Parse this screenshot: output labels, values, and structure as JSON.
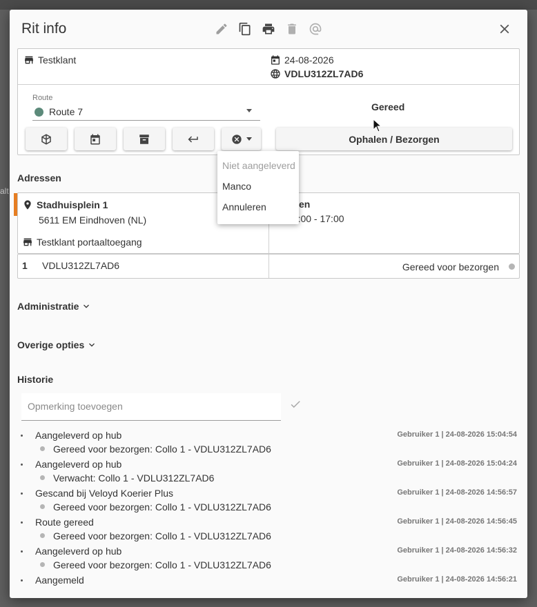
{
  "backdrop": {
    "left_fragment": "alt"
  },
  "dialog": {
    "title": "Rit info",
    "header_icons": [
      "pencil-icon",
      "copy-icon",
      "print-icon",
      "trash-icon",
      "at-icon",
      "close-icon"
    ]
  },
  "info": {
    "customer": "Testklant",
    "date": "24-08-2026",
    "tracking_code": "VDLU312ZL7AD6",
    "route_label": "Route",
    "route_value": "Route 7",
    "route_color": "#5c8a7a",
    "status": "Gereed"
  },
  "actions": {
    "buttons": [
      "box-icon",
      "calendar-icon",
      "archive-icon",
      "return-icon",
      "cancel-dropdown"
    ],
    "wide_button": "Ophalen / Bezorgen"
  },
  "dropdown_menu": {
    "items": [
      "Niet aangeleverd",
      "Manco",
      "Annuleren"
    ]
  },
  "addresses": {
    "section_title": "Adressen",
    "street": "Stadhuisplein 1",
    "city": "5611 EM Eindhoven (NL)",
    "portal": "Testklant portaaltoegang",
    "type_fragment": "rgen",
    "time_window": "09:00 - 17:00",
    "accent_color": "#e67e22"
  },
  "collo": {
    "number": "1",
    "code": "VDLU312ZL7AD6",
    "status": "Gereed voor bezorgen"
  },
  "sections": {
    "administratie": "Administratie",
    "overige": "Overige opties",
    "historie": "Historie"
  },
  "comment": {
    "placeholder": "Opmerking toevoegen"
  },
  "history": [
    {
      "title": "Aangeleverd op hub",
      "sub": "Gereed voor bezorgen: Collo 1 - VDLU312ZL7AD6",
      "meta": "Gebruiker 1 | 24-08-2026 15:04:54"
    },
    {
      "title": "Aangeleverd op hub",
      "sub": "Verwacht: Collo 1 - VDLU312ZL7AD6",
      "meta": "Gebruiker 1 | 24-08-2026 15:04:24"
    },
    {
      "title": "Gescand bij Veloyd Koerier Plus",
      "sub": "Gereed voor bezorgen: Collo 1 - VDLU312ZL7AD6",
      "meta": "Gebruiker 1 | 24-08-2026 14:56:57"
    },
    {
      "title": "Route gereed",
      "sub": "Gereed voor bezorgen: Collo 1 - VDLU312ZL7AD6",
      "meta": "Gebruiker 1 | 24-08-2026 14:56:45"
    },
    {
      "title": "Aangeleverd op hub",
      "sub": "Gereed voor bezorgen: Collo 1 - VDLU312ZL7AD6",
      "meta": "Gebruiker 1 | 24-08-2026 14:56:32"
    },
    {
      "title": "Aangemeld",
      "sub": "",
      "meta": "Gebruiker 1 | 24-08-2026 14:56:21"
    }
  ]
}
